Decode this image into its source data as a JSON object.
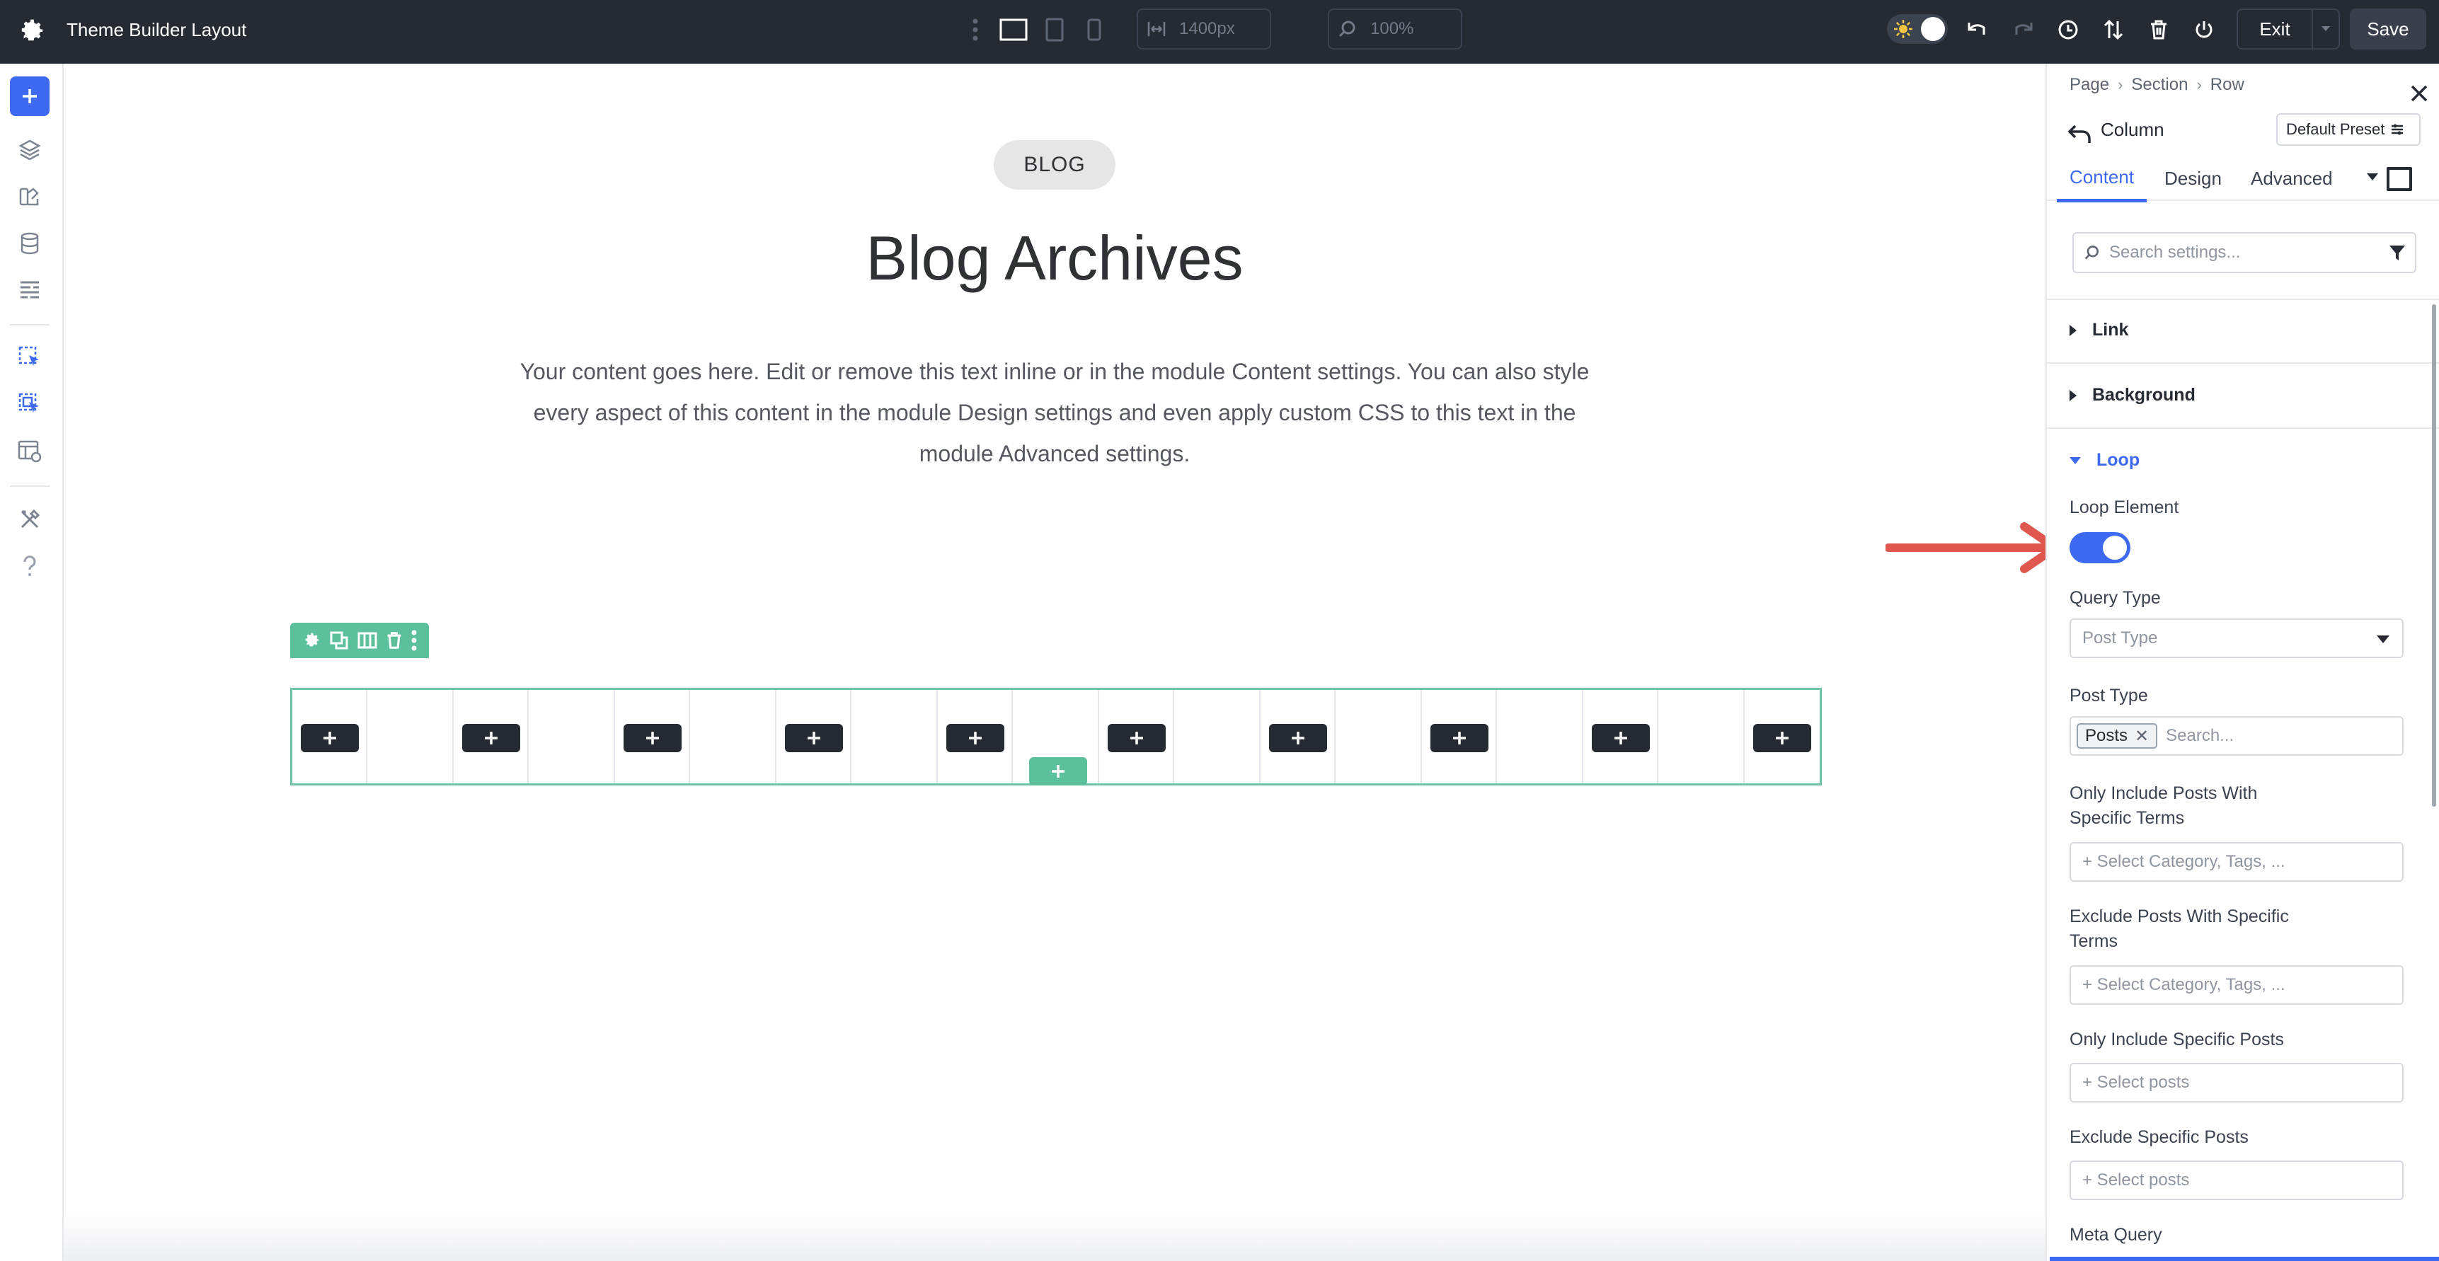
{
  "topbar": {
    "title": "Theme Builder Layout",
    "width_value": "1400px",
    "zoom_value": "100%",
    "exit_label": "Exit",
    "save_label": "Save"
  },
  "canvas": {
    "badge": "BLOG",
    "title": "Blog Archives",
    "body": "Your content goes here. Edit or remove this text inline or in the module Content settings. You can also style every aspect of this content in the module Design settings and even apply custom CSS to this text in the module Advanced settings."
  },
  "panel": {
    "breadcrumb": [
      "Page",
      "Section",
      "Row"
    ],
    "element_title": "Column",
    "preset_label": "Default Preset",
    "tabs": [
      "Content",
      "Design",
      "Advanced"
    ],
    "search_placeholder": "Search settings...",
    "sections": {
      "link": "Link",
      "background": "Background",
      "loop": "Loop"
    },
    "loop": {
      "loop_element_label": "Loop Element",
      "loop_element_on": true,
      "query_type_label": "Query Type",
      "query_type_value": "Post Type",
      "post_type_label": "Post Type",
      "post_type_chip": "Posts",
      "post_type_search_placeholder": "Search...",
      "include_terms_label_1": "Only Include Posts With",
      "include_terms_label_2": "Specific Terms",
      "include_terms_placeholder": "+ Select Category, Tags, ...",
      "exclude_terms_label_1": "Exclude Posts With Specific",
      "exclude_terms_label_2": "Terms",
      "exclude_terms_placeholder": "+ Select Category, Tags, ...",
      "include_posts_label": "Only Include Specific Posts",
      "include_posts_placeholder": "+ Select posts",
      "exclude_posts_label": "Exclude Specific Posts",
      "exclude_posts_placeholder": "+ Select posts",
      "meta_query_label": "Meta Query"
    }
  },
  "colors": {
    "accent": "#3d6af0",
    "row_green": "#5cc09a",
    "topbar_bg": "#262b33",
    "annotation_arrow": "#e0574f"
  },
  "icons": {
    "topbar": [
      "gear-icon",
      "more-vertical-icon",
      "desktop-icon",
      "tablet-icon",
      "phone-icon",
      "width-icon",
      "zoom-icon",
      "sun-icon",
      "undo-icon",
      "redo-icon",
      "history-icon",
      "sort-icon",
      "trash-icon",
      "power-icon",
      "chevron-down-icon"
    ],
    "leftbar": [
      "plus-icon",
      "layers-icon",
      "theme-icon",
      "database-icon",
      "layout-icon",
      "cursor-icon",
      "cursor-multi-icon",
      "layout-view-icon",
      "tools-icon",
      "help-icon"
    ],
    "row_toolbar": [
      "gear-icon",
      "duplicate-icon",
      "columns-icon",
      "trash-icon",
      "more-vertical-icon"
    ]
  }
}
